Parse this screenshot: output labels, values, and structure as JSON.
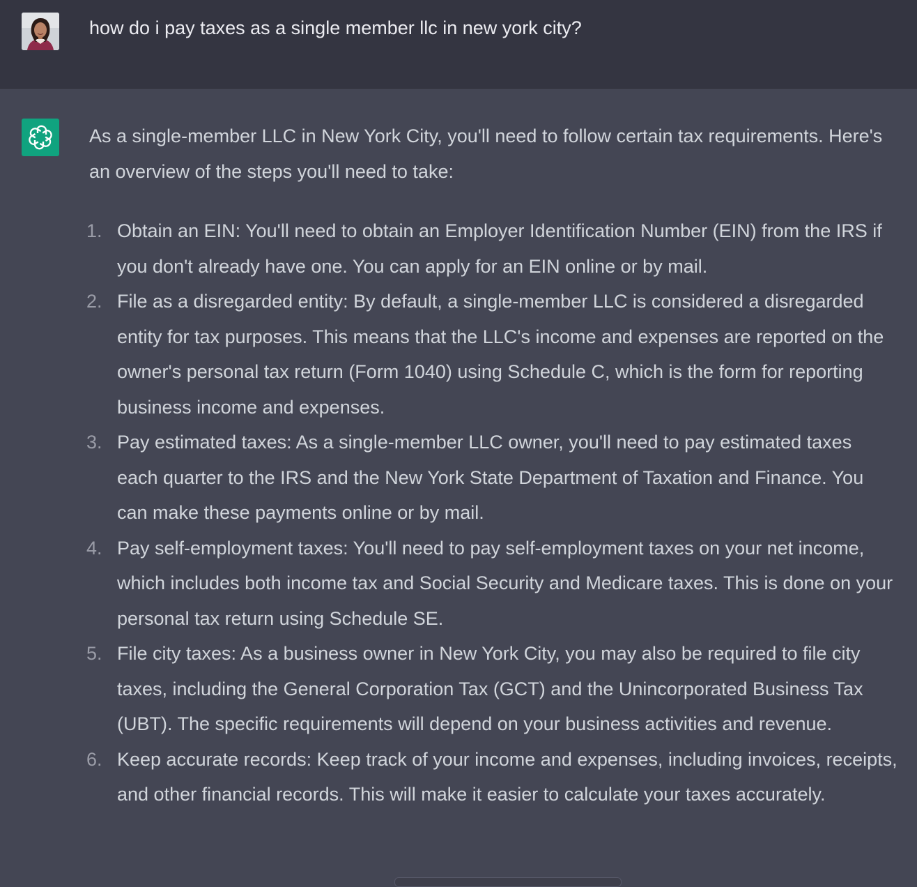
{
  "conversation": {
    "user_message": "how do i pay taxes as a single member llc in new york city?",
    "assistant_message": {
      "intro": "As a single-member LLC in New York City, you'll need to follow certain tax requirements. Here's an overview of the steps you'll need to take:",
      "steps": [
        {
          "number": "1.",
          "text": "Obtain an EIN: You'll need to obtain an Employer Identification Number (EIN) from the IRS if you don't already have one. You can apply for an EIN online or by mail."
        },
        {
          "number": "2.",
          "text": "File as a disregarded entity: By default, a single-member LLC is considered a disregarded entity for tax purposes. This means that the LLC's income and expenses are reported on the owner's personal tax return (Form 1040) using Schedule C, which is the form for reporting business income and expenses."
        },
        {
          "number": "3.",
          "text": "Pay estimated taxes: As a single-member LLC owner, you'll need to pay estimated taxes each quarter to the IRS and the New York State Department of Taxation and Finance. You can make these payments online or by mail."
        },
        {
          "number": "4.",
          "text": "Pay self-employment taxes: You'll need to pay self-employment taxes on your net income, which includes both income tax and Social Security and Medicare taxes. This is done on your personal tax return using Schedule SE."
        },
        {
          "number": "5.",
          "text": "File city taxes: As a business owner in New York City, you may also be required to file city taxes, including the General Corporation Tax (GCT) and the Unincorporated Business Tax (UBT). The specific requirements will depend on your business activities and revenue."
        },
        {
          "number": "6.",
          "text": "Keep accurate records: Keep track of your income and expenses, including invoices, receipts, and other financial records. This will make it easier to calculate your taxes accurately."
        }
      ]
    }
  },
  "icons": {
    "user_avatar": "user-avatar-photo",
    "assistant_avatar": "openai-logo-icon"
  },
  "colors": {
    "user_row_bg": "#343541",
    "assistant_row_bg": "#444654",
    "assistant_avatar_bg": "#10a37f",
    "text": "#d1d5db",
    "list_number": "#9a9ca7"
  }
}
